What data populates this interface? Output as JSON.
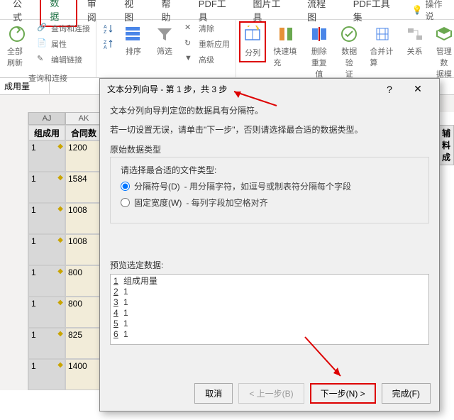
{
  "ribbon": {
    "tabs": [
      "公式",
      "数据",
      "审阅",
      "视图",
      "帮助",
      "PDF工具",
      "图片工具",
      "流程图",
      "PDF工具集"
    ],
    "active_tab": "数据",
    "help_label": "操作说",
    "groups": {
      "query": {
        "items": [
          "查询和连接",
          "属性",
          "编辑链接"
        ],
        "big_label": "全部刷新",
        "group_label": "查询和连接"
      },
      "sort": {
        "label1": "排序",
        "label2": "筛选",
        "clear": "清除",
        "reapply": "重新应用",
        "adv": "高级"
      },
      "data_tools": {
        "text_to_columns": "分列",
        "flash_fill": "快速填充",
        "remove_dup": "删除\n重复值",
        "validation": "数据验\n证",
        "consolidate": "合并计算",
        "relations": "关系",
        "manage": "管理数\n据模"
      }
    }
  },
  "namebox": "成用量",
  "sheet": {
    "col_headers": [
      "AJ",
      "AK"
    ],
    "headers_row": [
      "组成用量",
      "合同数量"
    ],
    "rows": [
      {
        "aj": "1",
        "ak": "1200"
      },
      {
        "aj": "1",
        "ak": "1584"
      },
      {
        "aj": "1",
        "ak": "1008"
      },
      {
        "aj": "1",
        "ak": "1008"
      },
      {
        "aj": "1",
        "ak": "800"
      },
      {
        "aj": "1",
        "ak": "800"
      },
      {
        "aj": "1",
        "ak": "825"
      },
      {
        "aj": "1",
        "ak": "1400"
      }
    ],
    "right_header": "辅料成"
  },
  "dialog": {
    "title": "文本分列向导 - 第 1 步，共 3 步",
    "intro1": "文本分列向导判定您的数据具有分隔符。",
    "intro2": "若一切设置无误，请单击\"下一步\"，否则请选择最合适的数据类型。",
    "fieldset_label": "原始数据类型",
    "choose_label": "请选择最合适的文件类型:",
    "radio1_label": "分隔符号(D)",
    "radio1_desc": "- 用分隔字符，如逗号或制表符分隔每个字段",
    "radio2_label": "固定宽度(W)",
    "radio2_desc": "- 每列字段加空格对齐",
    "preview_label": "预览选定数据:",
    "preview_lines": [
      "组成用量",
      "1",
      "1",
      "1",
      "1",
      "1"
    ],
    "buttons": {
      "cancel": "取消",
      "back": "< 上一步(B)",
      "next": "下一步(N) >",
      "finish": "完成(F)"
    }
  }
}
